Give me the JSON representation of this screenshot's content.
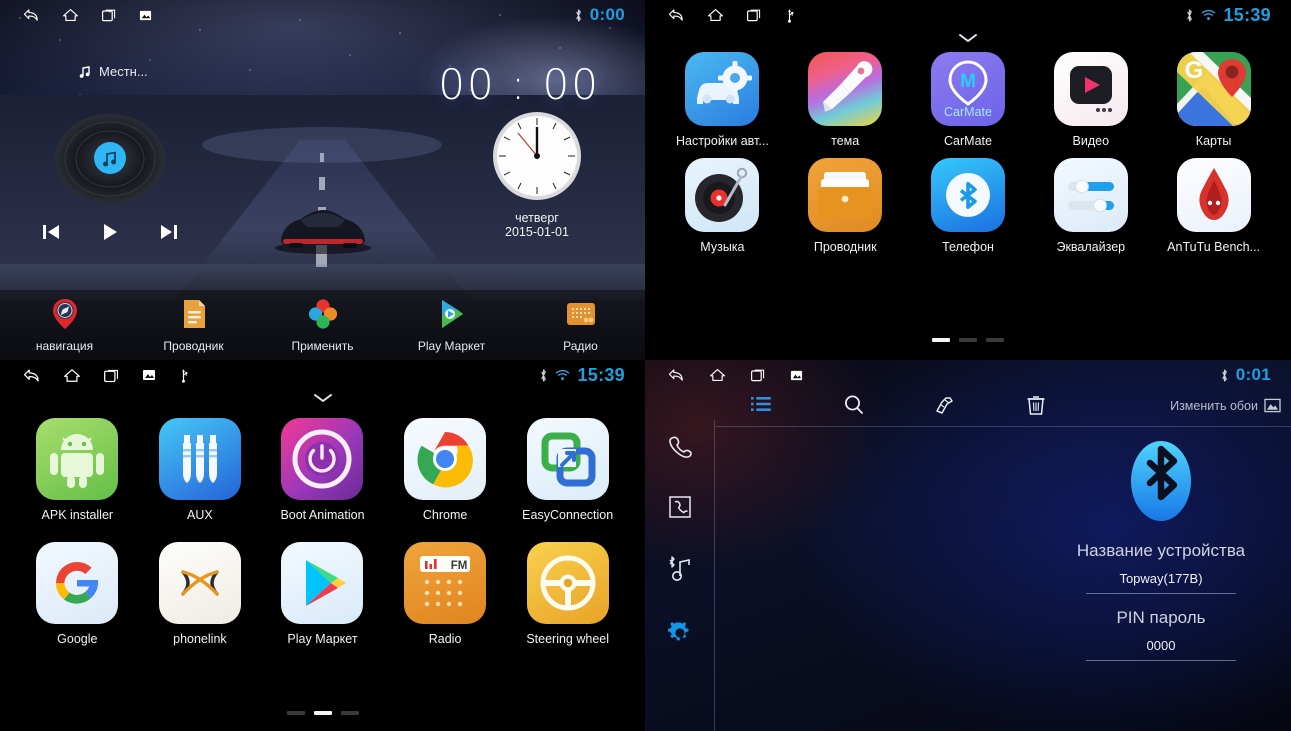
{
  "panels": {
    "home": {
      "name": "car-launcher-home",
      "statusbar": {
        "icons": [
          "back-icon",
          "home-icon",
          "recents-icon",
          "screenshot-icon"
        ],
        "bluetooth": "bluetooth-icon",
        "clock": "0:00"
      },
      "track_label": "Местн...",
      "big_clock": "00 : 00",
      "analog_clock": {
        "weekday": "четверг",
        "date": "2015-01-01"
      },
      "media": {
        "prev": "previous-track-icon",
        "play": "play-icon",
        "next": "next-track-icon"
      },
      "dock": [
        {
          "label": "навигация",
          "icon": "navigation-pin-icon"
        },
        {
          "label": "Проводник",
          "icon": "file-manager-icon"
        },
        {
          "label": "Применить",
          "icon": "apply-flower-icon"
        },
        {
          "label": "Play Маркет",
          "icon": "play-store-icon"
        },
        {
          "label": "Радио",
          "icon": "radio-icon"
        }
      ]
    },
    "drawer1": {
      "name": "app-drawer-page-1",
      "statusbar": {
        "icons": [
          "back-icon",
          "home-icon",
          "recents-icon",
          "usb-icon"
        ],
        "bluetooth": "bluetooth-icon",
        "wifi": "wifi-icon",
        "clock": "15:39"
      },
      "apps": [
        {
          "label": "Настройки авт...",
          "icon": "car-settings-icon"
        },
        {
          "label": "тема",
          "icon": "theme-brush-icon"
        },
        {
          "label": "CarMate",
          "icon": "carmate-icon"
        },
        {
          "label": "Видео",
          "icon": "video-player-icon"
        },
        {
          "label": "Карты",
          "icon": "google-maps-icon"
        },
        {
          "label": "Музыка",
          "icon": "music-turntable-icon"
        },
        {
          "label": "Проводник",
          "icon": "file-manager-icon"
        },
        {
          "label": "Телефон",
          "icon": "bluetooth-phone-icon"
        },
        {
          "label": "Эквалайзер",
          "icon": "equalizer-icon"
        },
        {
          "label": "AnTuTu Bench...",
          "icon": "antutu-icon"
        }
      ],
      "page_dots": {
        "count": 3,
        "active": 0
      }
    },
    "drawer2": {
      "name": "app-drawer-page-2",
      "statusbar": {
        "icons": [
          "back-icon",
          "home-icon",
          "recents-icon",
          "screenshot-icon",
          "usb-icon"
        ],
        "bluetooth": "bluetooth-icon",
        "wifi": "wifi-icon",
        "clock": "15:39"
      },
      "apps": [
        {
          "label": "APK installer",
          "icon": "android-robot-icon"
        },
        {
          "label": "AUX",
          "icon": "aux-jack-icon"
        },
        {
          "label": "Boot Animation",
          "icon": "power-boot-icon"
        },
        {
          "label": "Chrome",
          "icon": "chrome-icon"
        },
        {
          "label": "EasyConnection",
          "icon": "easyconnection-icon"
        },
        {
          "label": "Google",
          "icon": "google-g-icon"
        },
        {
          "label": "phonelink",
          "icon": "phonelink-icon"
        },
        {
          "label": "Play Маркет",
          "icon": "play-store-icon"
        },
        {
          "label": "Radio",
          "icon": "fm-radio-icon"
        },
        {
          "label": "Steering wheel",
          "icon": "steering-wheel-icon"
        }
      ],
      "page_dots": {
        "count": 3,
        "active": 1
      }
    },
    "bluetooth": {
      "name": "bluetooth-settings",
      "statusbar": {
        "icons": [
          "back-icon",
          "home-icon",
          "recents-icon",
          "screenshot-icon"
        ],
        "bluetooth": "bluetooth-icon",
        "clock": "0:01"
      },
      "toolbar": [
        {
          "icon": "list-icon",
          "active": true
        },
        {
          "icon": "search-icon",
          "active": false
        },
        {
          "icon": "edit-hand-icon",
          "active": false
        },
        {
          "icon": "trash-icon",
          "active": false
        }
      ],
      "change_wallpaper": {
        "label": "Изменить обои",
        "icon": "image-icon"
      },
      "sidebar": [
        {
          "icon": "dialpad-phone-icon",
          "active": false
        },
        {
          "icon": "call-log-icon",
          "active": false
        },
        {
          "icon": "bluetooth-music-icon",
          "active": false
        },
        {
          "icon": "gear-icon",
          "active": true
        }
      ],
      "logo_icon": "bluetooth-logo-icon",
      "fields": [
        {
          "label": "Название устройства",
          "value": "Topway(177B)"
        },
        {
          "label": "PIN пароль",
          "value": "0000"
        }
      ]
    }
  },
  "colors": {
    "accent_blue": "#1e9fe0",
    "bt_blue": "#2aa8f2",
    "white": "#ffffff"
  }
}
